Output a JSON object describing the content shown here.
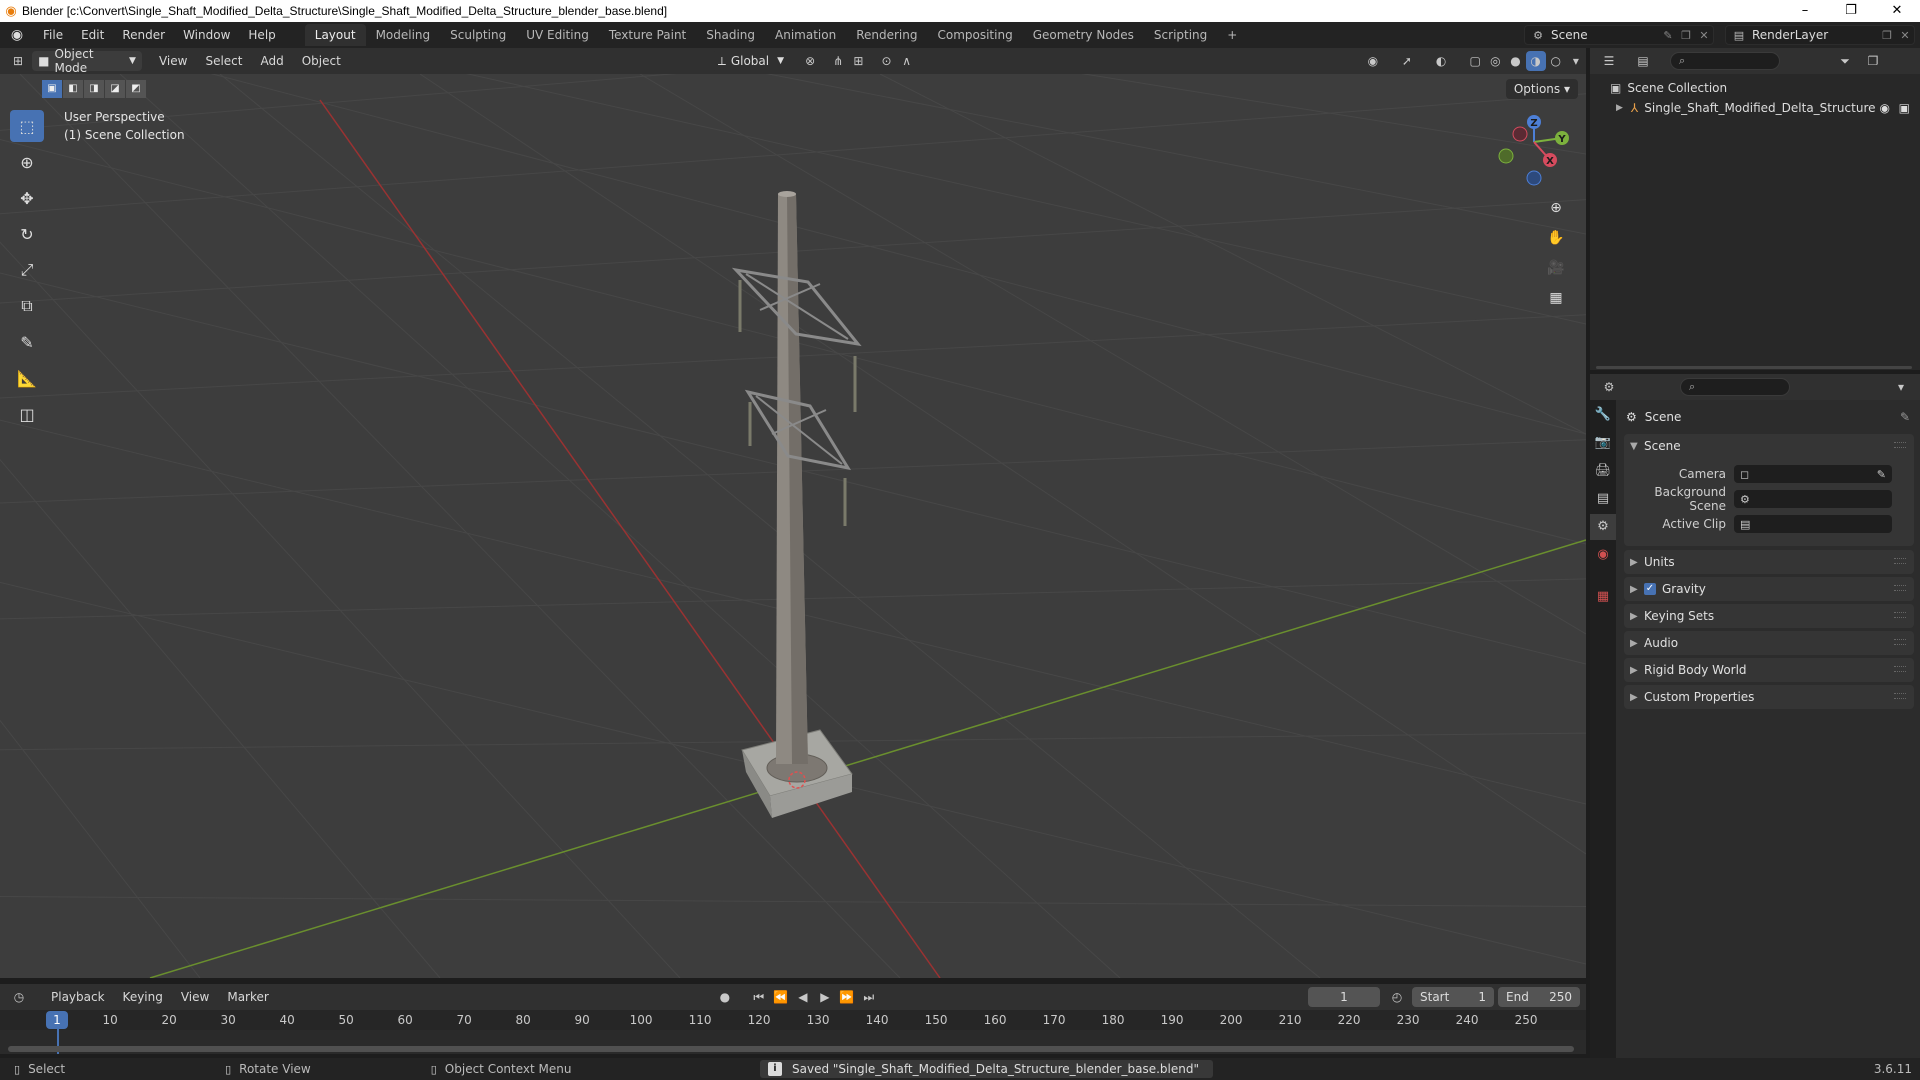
{
  "window": {
    "title": "Blender [c:\\Convert\\Single_Shaft_Modified_Delta_Structure\\Single_Shaft_Modified_Delta_Structure_blender_base.blend]",
    "controls": [
      "–",
      "❐",
      "✕"
    ]
  },
  "menubar": {
    "menus": [
      "File",
      "Edit",
      "Render",
      "Window",
      "Help"
    ],
    "workspaces": [
      "Layout",
      "Modeling",
      "Sculpting",
      "UV Editing",
      "Texture Paint",
      "Shading",
      "Animation",
      "Rendering",
      "Compositing",
      "Geometry Nodes",
      "Scripting"
    ],
    "add_tab": "+",
    "active_workspace": "Layout",
    "scene": "Scene",
    "render_layer": "RenderLayer"
  },
  "viewport_header": {
    "mode": "Object Mode",
    "menus": [
      "View",
      "Select",
      "Add",
      "Object"
    ],
    "transform_orientation": "Global"
  },
  "viewport": {
    "perspective": "User Perspective",
    "collection": "(1) Scene Collection",
    "options": "Options",
    "gizmo": {
      "z": "Z",
      "y": "Y",
      "x": "X"
    }
  },
  "timeline": {
    "menus": [
      "Playback",
      "Keying",
      "View",
      "Marker"
    ],
    "current_frame": "1",
    "start_label": "Start",
    "start": "1",
    "end_label": "End",
    "end": "250",
    "ticks": [
      "10",
      "20",
      "30",
      "40",
      "50",
      "60",
      "70",
      "80",
      "90",
      "100",
      "110",
      "120",
      "130",
      "140",
      "150",
      "160",
      "170",
      "180",
      "190",
      "200",
      "210",
      "220",
      "230",
      "240",
      "250"
    ],
    "playhead": "1"
  },
  "statusbar": {
    "select": "Select",
    "rotate": "Rotate View",
    "context": "Object Context Menu",
    "message": "Saved \"Single_Shaft_Modified_Delta_Structure_blender_base.blend\"",
    "version": "3.6.11"
  },
  "outliner": {
    "root": "Scene Collection",
    "object": "Single_Shaft_Modified_Delta_Structure"
  },
  "properties": {
    "title": "Scene",
    "scene_panel": "Scene",
    "camera_label": "Camera",
    "bg_scene_label": "Background Scene",
    "active_clip_label": "Active Clip",
    "panels": [
      "Units",
      "Gravity",
      "Keying Sets",
      "Audio",
      "Rigid Body World",
      "Custom Properties"
    ]
  }
}
